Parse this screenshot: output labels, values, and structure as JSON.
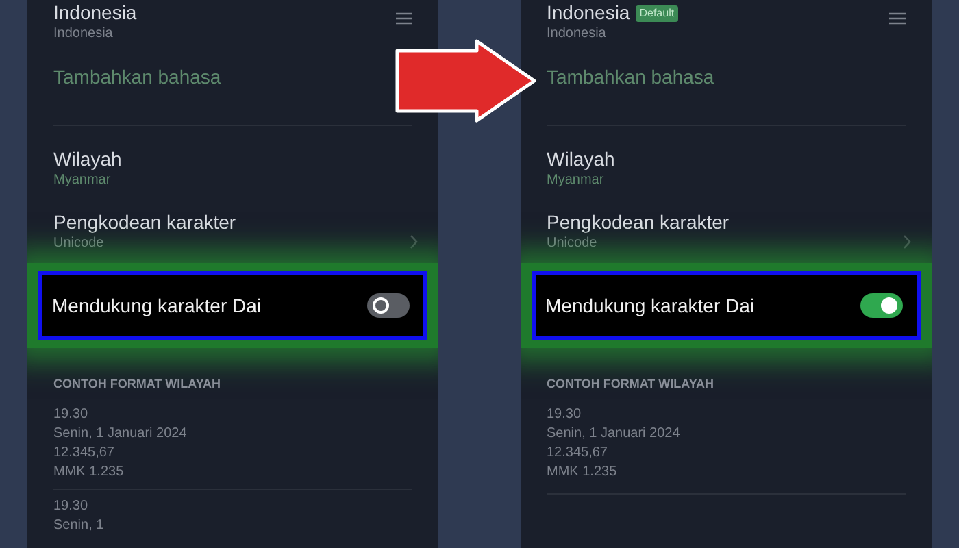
{
  "screens": [
    {
      "language": {
        "title": "Indonesia",
        "subtitle": "Indonesia"
      },
      "add_language": "Tambahkan bahasa",
      "region": {
        "title": "Wilayah",
        "value": "Myanmar"
      },
      "encoding": {
        "title": "Pengkodean karakter",
        "value": "Unicode"
      },
      "dai_support": {
        "label": "Mendukung karakter Dai",
        "on": false
      },
      "format_header": "CONTOH FORMAT WILAYAH",
      "format_examples": [
        [
          "19.30",
          "Senin, 1 Januari 2024",
          "12.345,67",
          "MMK 1.235"
        ],
        [
          "19.30",
          "Senin, 1"
        ]
      ]
    },
    {
      "language": {
        "title": "Indonesia",
        "badge": "Default",
        "subtitle": "Indonesia"
      },
      "add_language": "Tambahkan bahasa",
      "region": {
        "title": "Wilayah",
        "value": "Myanmar"
      },
      "encoding": {
        "title": "Pengkodean karakter",
        "value": "Unicode"
      },
      "dai_support": {
        "label": "Mendukung karakter Dai",
        "on": true
      },
      "format_header": "CONTOH FORMAT WILAYAH",
      "format_examples": [
        [
          "19.30",
          "Senin, 1 Januari 2024",
          "12.345,67",
          "MMK 1.235"
        ]
      ]
    }
  ]
}
